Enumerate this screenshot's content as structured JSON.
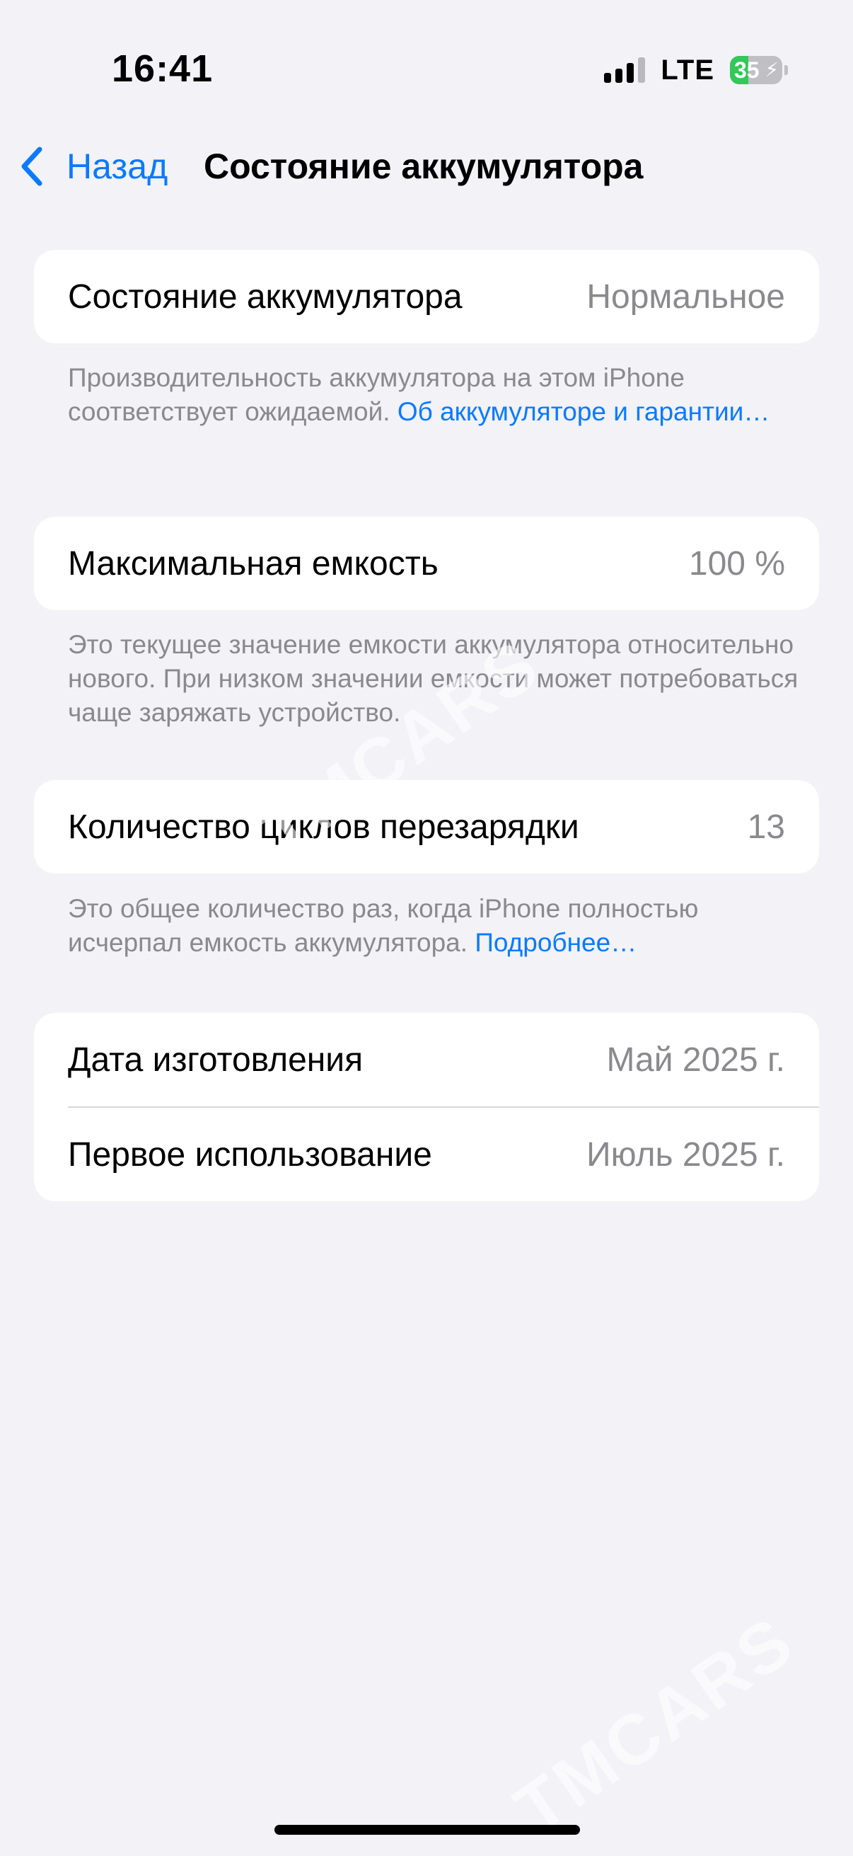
{
  "status_bar": {
    "time": "16:41",
    "network": "LTE",
    "battery_level": "35",
    "battery_fraction": 0.35,
    "charging": true
  },
  "nav": {
    "back_label": "Назад",
    "title": "Состояние аккумулятора"
  },
  "sections": {
    "health": {
      "label": "Состояние аккумулятора",
      "value": "Нормальное",
      "footer_text": "Производительность аккумулятора на этом iPhone соответствует ожидаемой. ",
      "footer_link": "Об аккумуляторе и гарантии…"
    },
    "capacity": {
      "label": "Максимальная емкость",
      "value": "100 %",
      "footer_text": "Это текущее значение емкости аккумулятора относительно нового. При низком значении емкости может потребоваться чаще заряжать устройство."
    },
    "cycles": {
      "label": "Количество циклов перезарядки",
      "value": "13",
      "footer_text": "Это общее количество раз, когда iPhone полностью исчерпал емкость аккумулятора. ",
      "footer_link": "Подробнее…"
    },
    "dates": {
      "manufacture_label": "Дата изготовления",
      "manufacture_value": "Май 2025 г.",
      "first_use_label": "Первое использование",
      "first_use_value": "Июль 2025 г."
    }
  },
  "watermark": "TMCARS",
  "colors": {
    "accent": "#0A7AFF",
    "background": "#F2F2F7",
    "battery_green": "#34C759"
  }
}
